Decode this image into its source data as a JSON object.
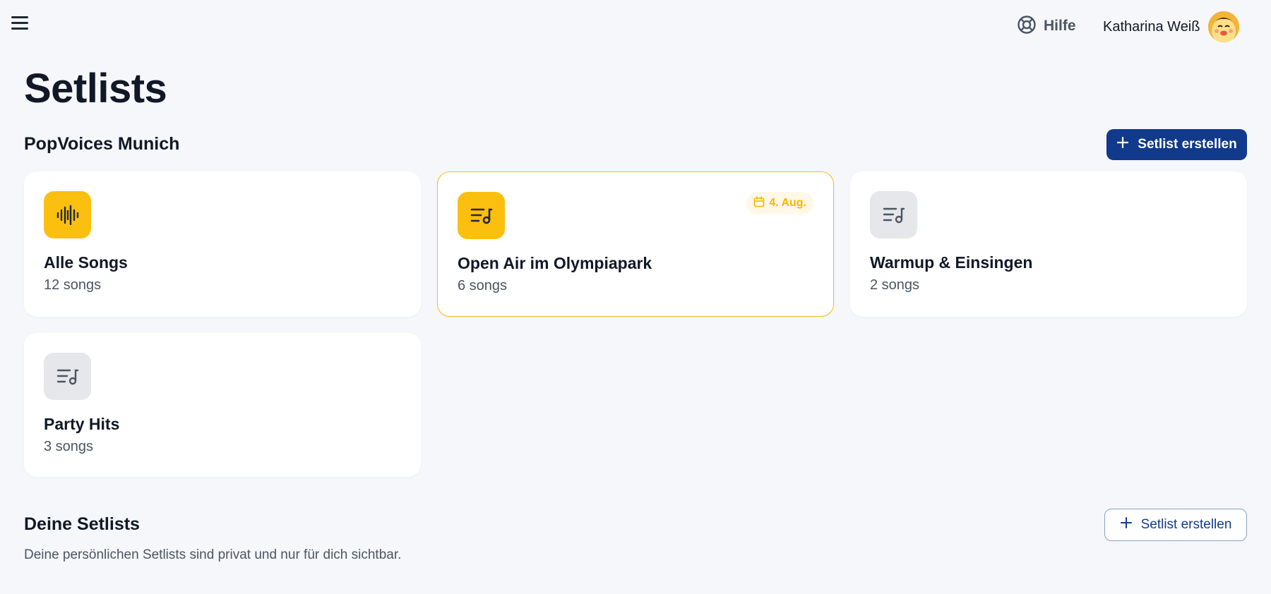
{
  "header": {
    "help_label": "Hilfe",
    "user_name": "Katharina Weiß"
  },
  "page": {
    "title": "Setlists"
  },
  "group_section": {
    "title": "PopVoices Munich",
    "create_button_label": "Setlist erstellen",
    "cards": [
      {
        "title": "Alle Songs",
        "count": "12 songs",
        "icon": "audio-waveform-icon",
        "icon_style": "yellow"
      },
      {
        "title": "Open Air im Olympiapark",
        "count": "6 songs",
        "icon": "setlist-music-icon",
        "icon_style": "yellow",
        "date_badge": "4. Aug.",
        "highlighted": true
      },
      {
        "title": "Warmup & Einsingen",
        "count": "2 songs",
        "icon": "setlist-music-icon",
        "icon_style": "gray"
      },
      {
        "title": "Party Hits",
        "count": "3 songs",
        "icon": "setlist-music-icon",
        "icon_style": "gray"
      }
    ]
  },
  "personal_section": {
    "title": "Deine Setlists",
    "description": "Deine persönlichen Setlists sind privat und nur für dich sichtbar.",
    "create_button_label": "Setlist erstellen"
  },
  "colors": {
    "primary": "#123a8c",
    "accent_yellow": "#fbbf0f",
    "background": "#f5f7fa"
  }
}
